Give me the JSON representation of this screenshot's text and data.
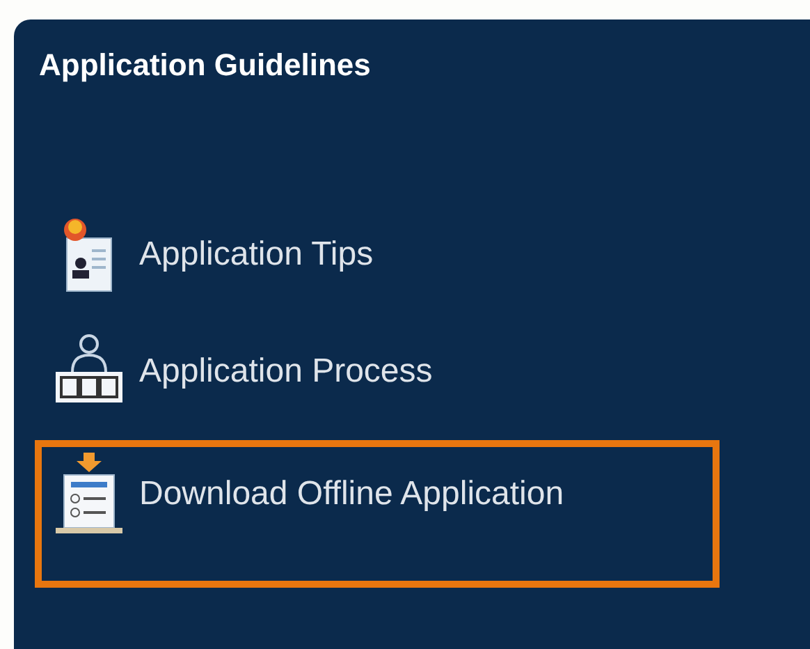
{
  "panel": {
    "title": "Application Guidelines",
    "items": [
      {
        "label": "Application Tips",
        "highlighted": false
      },
      {
        "label": "Application Process",
        "highlighted": false
      },
      {
        "label": "Download Offline Application",
        "highlighted": true
      }
    ]
  }
}
